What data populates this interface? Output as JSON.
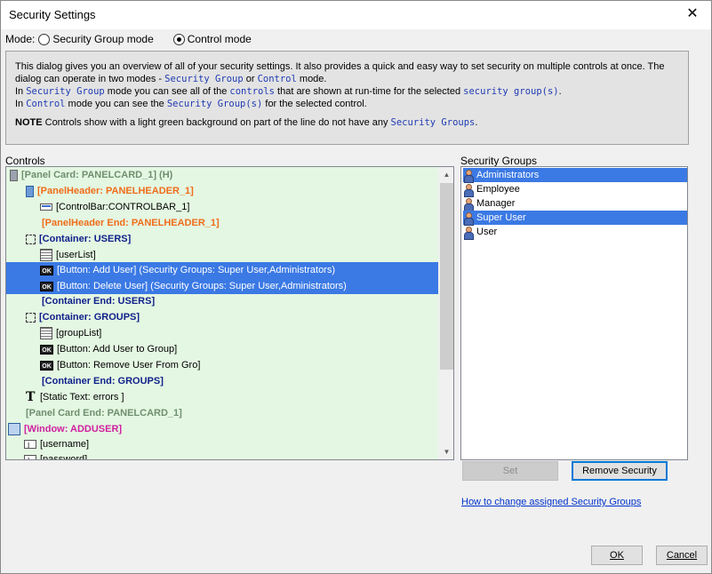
{
  "window": {
    "title": "Security Settings",
    "close_glyph": "✕"
  },
  "mode": {
    "label": "Mode:",
    "options": [
      {
        "label": "Security Group mode",
        "checked": false
      },
      {
        "label": "Control mode",
        "checked": true
      }
    ]
  },
  "info": {
    "line1": "This dialog gives you an overview of all of your security settings. It also provides a quick and easy way to set security on multiple controls at once. The",
    "line2_a": "dialog can operate in two modes - ",
    "line2_code1": "Security Group",
    "line2_b": " or ",
    "line2_code2": "Control",
    "line2_c": " mode.",
    "line3_a": "In ",
    "line3_code1": "Security Group",
    "line3_b": " mode you can see all of the ",
    "line3_code2": "controls",
    "line3_c": " that are shown at run-time for the selected ",
    "line3_code3": "security group(s)",
    "line3_d": ".",
    "line4_a": "In ",
    "line4_code1": "Control",
    "line4_b": " mode you can see the ",
    "line4_code2": "Security Group(s)",
    "line4_c": " for the selected control.",
    "note_label": "NOTE",
    "note_a": "  Controls show with a light green background on part of the line do not have any ",
    "note_code": "Security Groups",
    "note_b": "."
  },
  "controls": {
    "label": "Controls",
    "nodes": [
      {
        "text": "[Panel Card: PANELCARD_1]  (H)",
        "icon": "panel-card-icon"
      },
      {
        "text": "[PanelHeader: PANELHEADER_1]",
        "icon": "panel-header-icon"
      },
      {
        "text": "[ControlBar:CONTROLBAR_1]",
        "icon": "control-bar-icon"
      },
      {
        "text": "[PanelHeader End: PANELHEADER_1]",
        "icon": ""
      },
      {
        "text": "[Container: USERS]",
        "icon": "container-icon"
      },
      {
        "text": "[userList]",
        "icon": "list-grid-icon"
      },
      {
        "text": "[Button: Add User] (Security Groups: Super User,Administrators)",
        "icon": "button-icon"
      },
      {
        "text": "[Button: Delete User]  (Security Groups: Super User,Administrators)",
        "icon": "button-icon"
      },
      {
        "text": "[Container End: USERS]",
        "icon": ""
      },
      {
        "text": "[Container: GROUPS]",
        "icon": "container-icon"
      },
      {
        "text": "[groupList]",
        "icon": "list-grid-icon"
      },
      {
        "text": "[Button: Add User to Group]",
        "icon": "button-icon"
      },
      {
        "text": "[Button: Remove User From Gro]",
        "icon": "button-icon"
      },
      {
        "text": "[Container End: GROUPS]",
        "icon": ""
      },
      {
        "text": "[Static Text: errors ]",
        "icon": "static-text-icon"
      },
      {
        "text": "[Panel Card End: PANELCARD_1]",
        "icon": ""
      },
      {
        "text": "[Window: ADDUSER]",
        "icon": "window-icon"
      },
      {
        "text": "[username]",
        "icon": "text-field-icon"
      },
      {
        "text": "[password]",
        "icon": "text-field-icon"
      }
    ],
    "button_icon_text": "OK"
  },
  "security_groups": {
    "label": "Security Groups",
    "items": [
      {
        "name": "Administrators",
        "selected": true
      },
      {
        "name": "Employee",
        "selected": false
      },
      {
        "name": "Manager",
        "selected": false
      },
      {
        "name": "Super User",
        "selected": true
      },
      {
        "name": "User",
        "selected": false
      }
    ]
  },
  "buttons": {
    "set": "Set",
    "remove_security": "Remove Security",
    "ok": "OK",
    "cancel": "Cancel"
  },
  "help_link": "How to change assigned Security Groups",
  "colors": {
    "selection": "#3b79e4",
    "tree_bg": "#e4f7e2",
    "link": "#0033cc"
  }
}
